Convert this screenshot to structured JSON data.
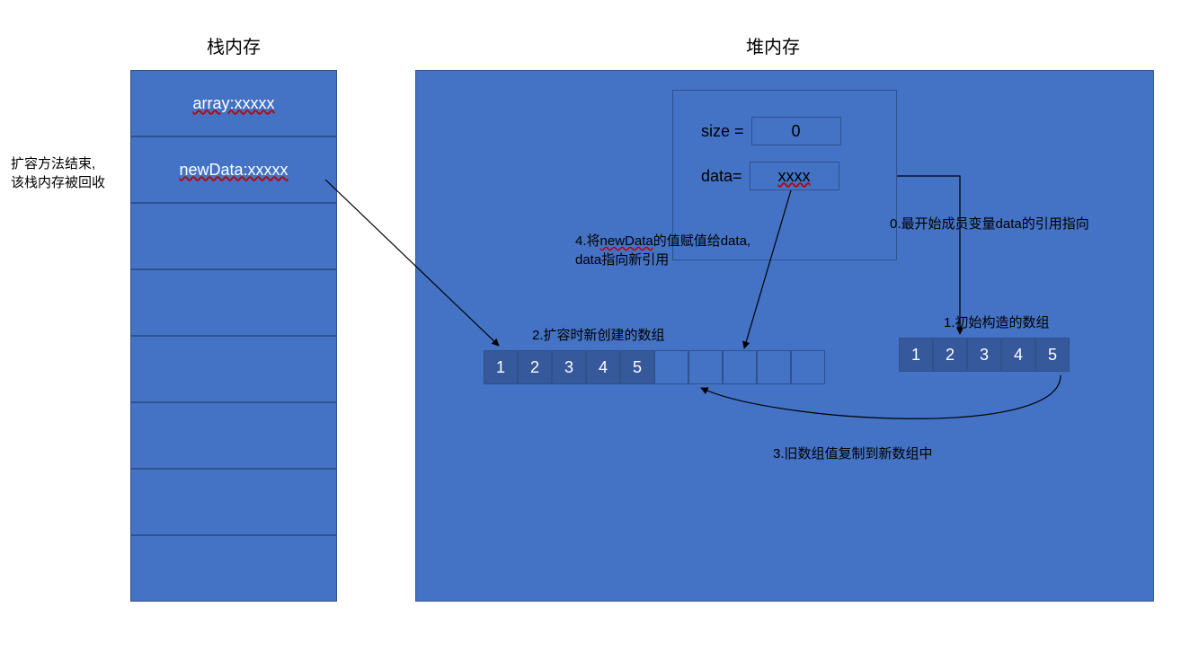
{
  "titles": {
    "stack": "栈内存",
    "heap": "堆内存"
  },
  "stack": {
    "row0": "array:xxxxx",
    "row1": "newData:xxxxx"
  },
  "sideNote": {
    "line1": "扩容方法结束,",
    "line2": "该栈内存被回收"
  },
  "object": {
    "sizeLabel": "size = ",
    "sizeValue": "0",
    "dataLabel": "data= ",
    "dataValue": "xxxx"
  },
  "labels": {
    "l0": "0.最开始成员变量data的引用指向",
    "l1": "1.初始构造的数组",
    "l2": "2.扩容时新创建的数组",
    "l3": "3.旧数组值复制到新数组中",
    "l4a": "4.将newData的值赋值给data,",
    "l4b": "data指向新引用"
  },
  "newArray": [
    "1",
    "2",
    "3",
    "4",
    "5",
    "",
    "",
    "",
    "",
    ""
  ],
  "oldArray": [
    "1",
    "2",
    "3",
    "4",
    "5"
  ]
}
